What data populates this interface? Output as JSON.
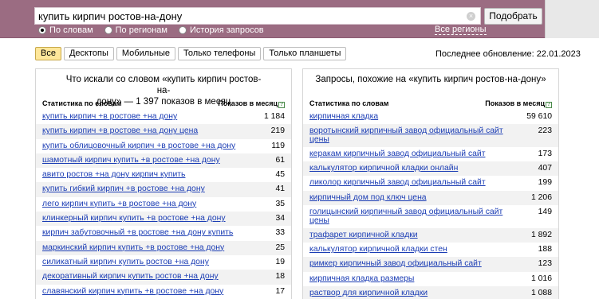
{
  "search": {
    "query": "купить кирпич ростов-на-дону",
    "clear_icon": "×",
    "submit_label": "Подобрать"
  },
  "modes": [
    {
      "label": "По словам",
      "selected": true
    },
    {
      "label": "По регионам",
      "selected": false
    },
    {
      "label": "История запросов",
      "selected": false
    }
  ],
  "all_regions_label": "Все регионы",
  "tabs": [
    {
      "label": "Все",
      "active": true
    },
    {
      "label": "Десктопы",
      "active": false
    },
    {
      "label": "Мобильные",
      "active": false
    },
    {
      "label": "Только телефоны",
      "active": false
    },
    {
      "label": "Только планшеты",
      "active": false
    }
  ],
  "updated_label": "Последнее обновление: 22.01.2023",
  "left_panel": {
    "title_line1": "Что искали со словом «купить кирпич ростов-на-",
    "title_line2": "дону» — 1 397 показов в месяц",
    "col_phrase": "Статистика по словам",
    "col_count": "Показов в месяц",
    "help_icon": "?",
    "rows": [
      {
        "phrase": "купить кирпич +в ростове +на дону",
        "count": "1 184"
      },
      {
        "phrase": "купить кирпич +в ростове +на дону цена",
        "count": "219"
      },
      {
        "phrase": "купить облицовочный кирпич +в ростове +на дону",
        "count": "119"
      },
      {
        "phrase": "шамотный кирпич купить +в ростове +на дону",
        "count": "61"
      },
      {
        "phrase": "авито ростов +на дону кирпич купить",
        "count": "45"
      },
      {
        "phrase": "купить гибкий кирпич +в ростове +на дону",
        "count": "41"
      },
      {
        "phrase": "лего кирпич купить +в ростове +на дону",
        "count": "35"
      },
      {
        "phrase": "клинкерный кирпич купить +в ростове +на дону",
        "count": "34"
      },
      {
        "phrase": "кирпич забутовочный +в ростове +на дону купить",
        "count": "33"
      },
      {
        "phrase": "маркинский кирпич купить +в ростове +на дону",
        "count": "25"
      },
      {
        "phrase": "силикатный кирпич купить ростов +на дону",
        "count": "19"
      },
      {
        "phrase": "декоративный кирпич купить ростов +на дону",
        "count": "18"
      },
      {
        "phrase": "славянский кирпич купить +в ростове +на дону",
        "count": "17"
      }
    ]
  },
  "right_panel": {
    "title": "Запросы, похожие на «купить кирпич ростов-на-дону»",
    "col_phrase": "Статистика по словам",
    "col_count": "Показов в месяц",
    "help_icon": "?",
    "rows": [
      {
        "lines": [
          "кирпичная кладка"
        ],
        "count": "59 610"
      },
      {
        "lines": [
          "воротынский кирпичный завод официальный сайт",
          "цены"
        ],
        "count": "223"
      },
      {
        "lines": [
          "керакам кирпичный завод официальный сайт"
        ],
        "count": "173"
      },
      {
        "lines": [
          "калькулятор кирпичной кладки онлайн"
        ],
        "count": "407"
      },
      {
        "lines": [
          "ликолор кирпичный завод официальный сайт"
        ],
        "count": "199"
      },
      {
        "lines": [
          "кирпичный дом под ключ цена"
        ],
        "count": "1 206"
      },
      {
        "lines": [
          "голицынский кирпичный завод официальный сайт",
          "цены"
        ],
        "count": "149"
      },
      {
        "lines": [
          "трафарет кирпичной кладки"
        ],
        "count": "1 892"
      },
      {
        "lines": [
          "калькулятор кирпичной кладки стен"
        ],
        "count": "188"
      },
      {
        "lines": [
          "римкер кирпичный завод официальный сайт"
        ],
        "count": "123"
      },
      {
        "lines": [
          "кирпичная кладка размеры"
        ],
        "count": "1 016"
      },
      {
        "lines": [
          "раствор для кирпичной кладки"
        ],
        "count": "1 088"
      }
    ]
  }
}
